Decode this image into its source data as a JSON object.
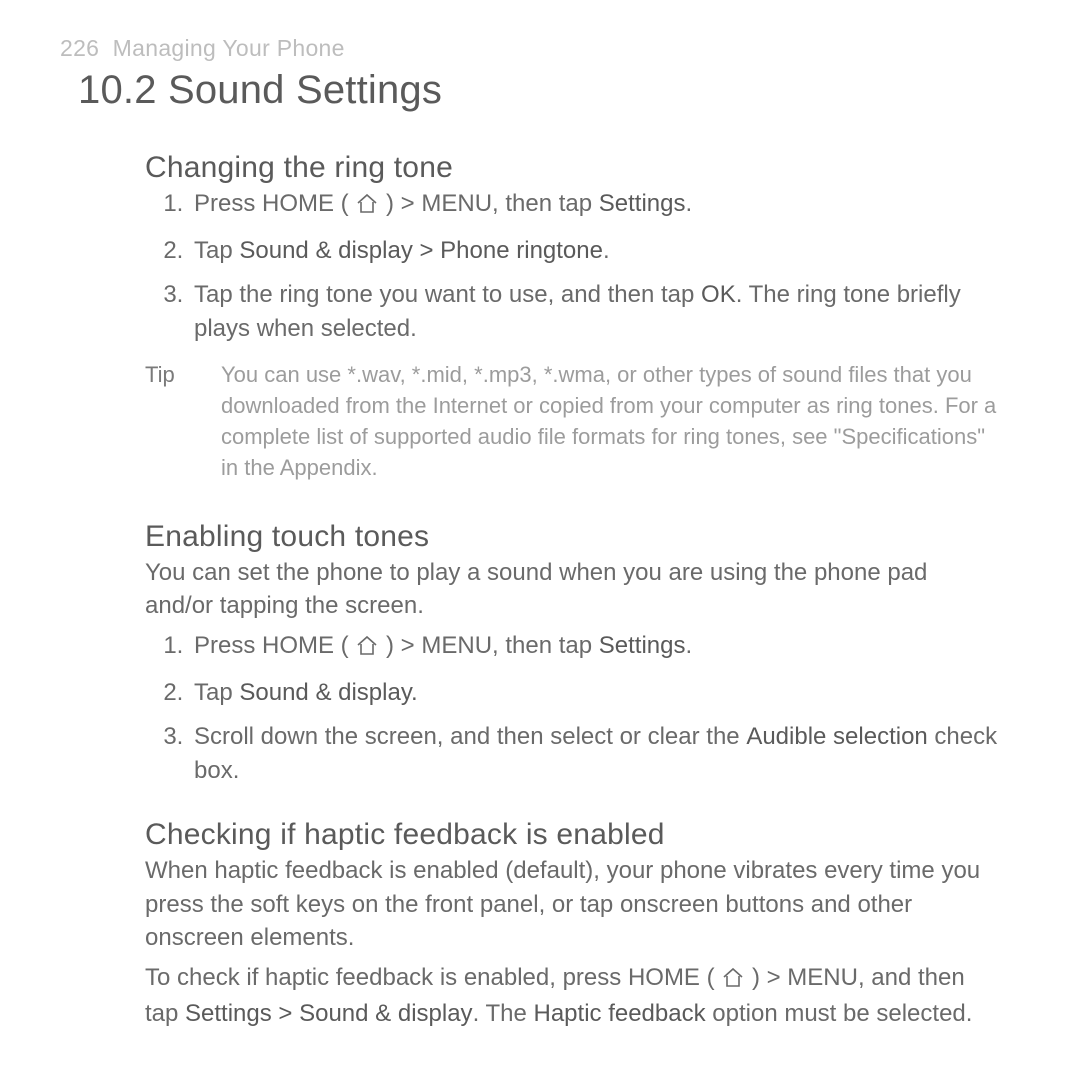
{
  "header": {
    "page_number": "226",
    "chapter": "Managing Your Phone"
  },
  "title": "10.2  Sound Settings",
  "s1": {
    "heading": "Changing the ring tone",
    "li1_a": "Press HOME ( ",
    "li1_b": " ) > MENU, then tap ",
    "li1_c": "Settings",
    "li1_d": ".",
    "li2_a": "Tap ",
    "li2_b": "Sound & display > Phone ringtone",
    "li2_c": ".",
    "li3_a": "Tap the ring tone you want to use, and then tap ",
    "li3_b": "OK",
    "li3_c": ". The ring tone briefly plays when selected.",
    "tip_label": "Tip",
    "tip_text": "You can use *.wav, *.mid, *.mp3, *.wma, or other types of sound files that you downloaded from the Internet or copied from your computer as ring tones. For a complete list of supported audio file formats for ring tones, see \"Specifications\" in the Appendix."
  },
  "s2": {
    "heading": "Enabling touch tones",
    "intro": "You can set the phone to play a sound when you are using the phone pad and/or tapping the screen.",
    "li1_a": "Press HOME ( ",
    "li1_b": " ) > MENU, then tap ",
    "li1_c": "Settings",
    "li1_d": ".",
    "li2_a": "Tap ",
    "li2_b": "Sound & display.",
    "li3_a": "Scroll down the screen, and then select or clear the ",
    "li3_b": "Audible selection",
    "li3_c": " check box."
  },
  "s3": {
    "heading": "Checking if haptic feedback is enabled",
    "p1": "When haptic feedback is enabled (default), your phone vibrates every time you press the soft keys on the front panel, or tap onscreen buttons and other onscreen elements.",
    "p2_a": "To check if haptic feedback is enabled, press HOME ( ",
    "p2_b": " ) > MENU, and then tap ",
    "p2_c": "Settings > Sound & display",
    "p2_d": ". The ",
    "p2_e": "Haptic feedback",
    "p2_f": " option must be selected."
  }
}
